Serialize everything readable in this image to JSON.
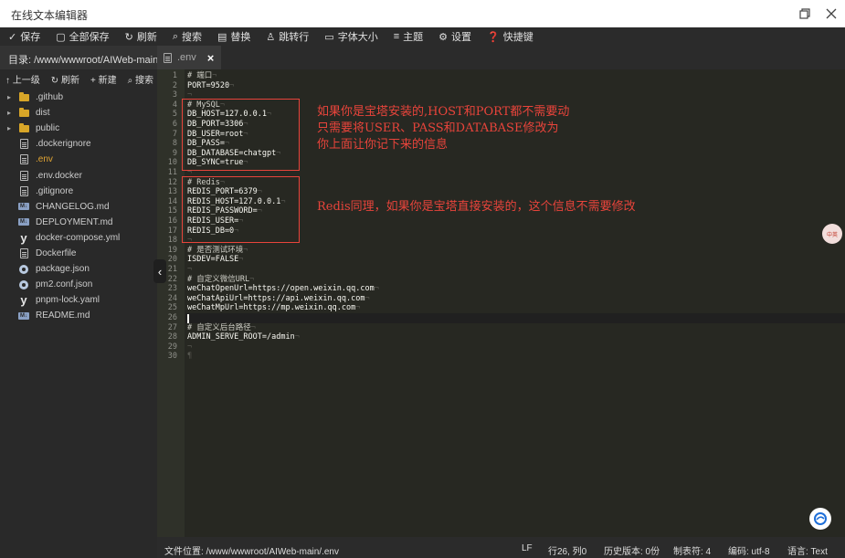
{
  "window": {
    "title": "在线文本编辑器"
  },
  "toolbar": {
    "items": [
      {
        "icon": "✓",
        "label": "保存"
      },
      {
        "icon": "▢",
        "label": "全部保存"
      },
      {
        "icon": "↻",
        "label": "刷新"
      },
      {
        "icon": "⌕",
        "label": "搜索"
      },
      {
        "icon": "▤",
        "label": "替换"
      },
      {
        "icon": "♙",
        "label": "跳转行"
      },
      {
        "icon": "▭",
        "label": "字体大小"
      },
      {
        "icon": "≡",
        "label": "主题"
      },
      {
        "icon": "⚙",
        "label": "设置"
      },
      {
        "icon": "❓",
        "label": "快捷键"
      }
    ]
  },
  "sidebar": {
    "path_label": "目录: /www/wwwroot/AIWeb-main",
    "actions": {
      "up": "↑ 上一级",
      "refresh": "↻ 刷新",
      "new": "+ 新建",
      "search": "⌕ 搜索"
    },
    "files": [
      {
        "name": ".github",
        "type": "folder"
      },
      {
        "name": "dist",
        "type": "folder"
      },
      {
        "name": "public",
        "type": "folder"
      },
      {
        "name": ".dockerignore",
        "type": "file"
      },
      {
        "name": ".env",
        "type": "file",
        "active": true
      },
      {
        "name": ".env.docker",
        "type": "file"
      },
      {
        "name": ".gitignore",
        "type": "file"
      },
      {
        "name": "CHANGELOG.md",
        "type": "md"
      },
      {
        "name": "DEPLOYMENT.md",
        "type": "md"
      },
      {
        "name": "docker-compose.yml",
        "type": "yml"
      },
      {
        "name": "Dockerfile",
        "type": "file"
      },
      {
        "name": "package.json",
        "type": "json"
      },
      {
        "name": "pm2.conf.json",
        "type": "json"
      },
      {
        "name": "pnpm-lock.yaml",
        "type": "yml"
      },
      {
        "name": "README.md",
        "type": "md"
      }
    ]
  },
  "tab": {
    "label": ".env",
    "close": "×"
  },
  "editor": {
    "lines": [
      "# 端口",
      "PORT=9520",
      "",
      "# MySQL",
      "DB_HOST=127.0.0.1",
      "DB_PORT=3306",
      "DB_USER=root",
      "DB_PASS=",
      "DB_DATABASE=chatgpt",
      "DB_SYNC=true",
      "",
      "# Redis",
      "REDIS_PORT=6379",
      "REDIS_HOST=127.0.0.1",
      "REDIS_PASSWORD=",
      "REDIS_USER=",
      "REDIS_DB=0",
      "",
      "# 是否测试环境",
      "ISDEV=FALSE",
      "",
      "# 自定义微信URL",
      "weChatOpenUrl=https://open.weixin.qq.com",
      "weChatApiUrl=https://api.weixin.qq.com",
      "weChatMpUrl=https://mp.weixin.qq.com",
      "",
      "# 自定义后台路径",
      "ADMIN_SERVE_ROOT=/admin",
      "",
      ""
    ],
    "cursor_line": 26,
    "annotations": {
      "mysql": [
        "如果你是宝塔安装的,HOST和PORT都不需要动",
        "只需要将USER、PASS和DATABASE修改为",
        "你上面让你记下来的信息"
      ],
      "redis": "Redis同理，如果你是宝塔直接安装的，这个信息不需要修改"
    },
    "annotation_color": "#e8443b"
  },
  "floating": {
    "translate_badge": "中英"
  },
  "status": {
    "file_path": "文件位置: /www/wwwroot/AIWeb-main/.env",
    "line_ending": "LF",
    "position": "行26, 列0",
    "history": "历史版本: 0份",
    "tab_size": "制表符: 4",
    "encoding": "编码: utf-8",
    "language": "语言: Text"
  }
}
